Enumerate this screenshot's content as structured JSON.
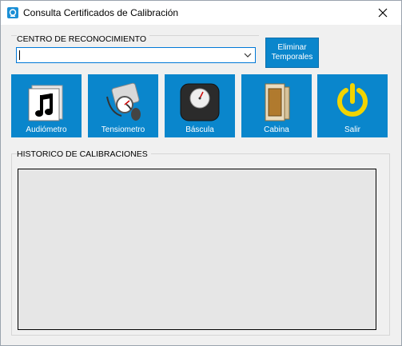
{
  "window": {
    "title": "Consulta Certificados de Calibración"
  },
  "centro": {
    "label": "CENTRO DE RECONOCIMIENTO",
    "value": ""
  },
  "eliminar": {
    "line1": "Eliminar",
    "line2": "Temporales"
  },
  "tools": [
    {
      "label": "Audiómetro",
      "icon": "music-folder-icon"
    },
    {
      "label": "Tensiometro",
      "icon": "blood-pressure-icon"
    },
    {
      "label": "Báscula",
      "icon": "scale-icon"
    },
    {
      "label": "Cabina",
      "icon": "booth-icon"
    },
    {
      "label": "Salir",
      "icon": "power-icon"
    }
  ],
  "historico": {
    "label": "HISTORICO DE CALIBRACIONES"
  },
  "colors": {
    "accent": "#0a86cc",
    "power": "#f2d400"
  }
}
